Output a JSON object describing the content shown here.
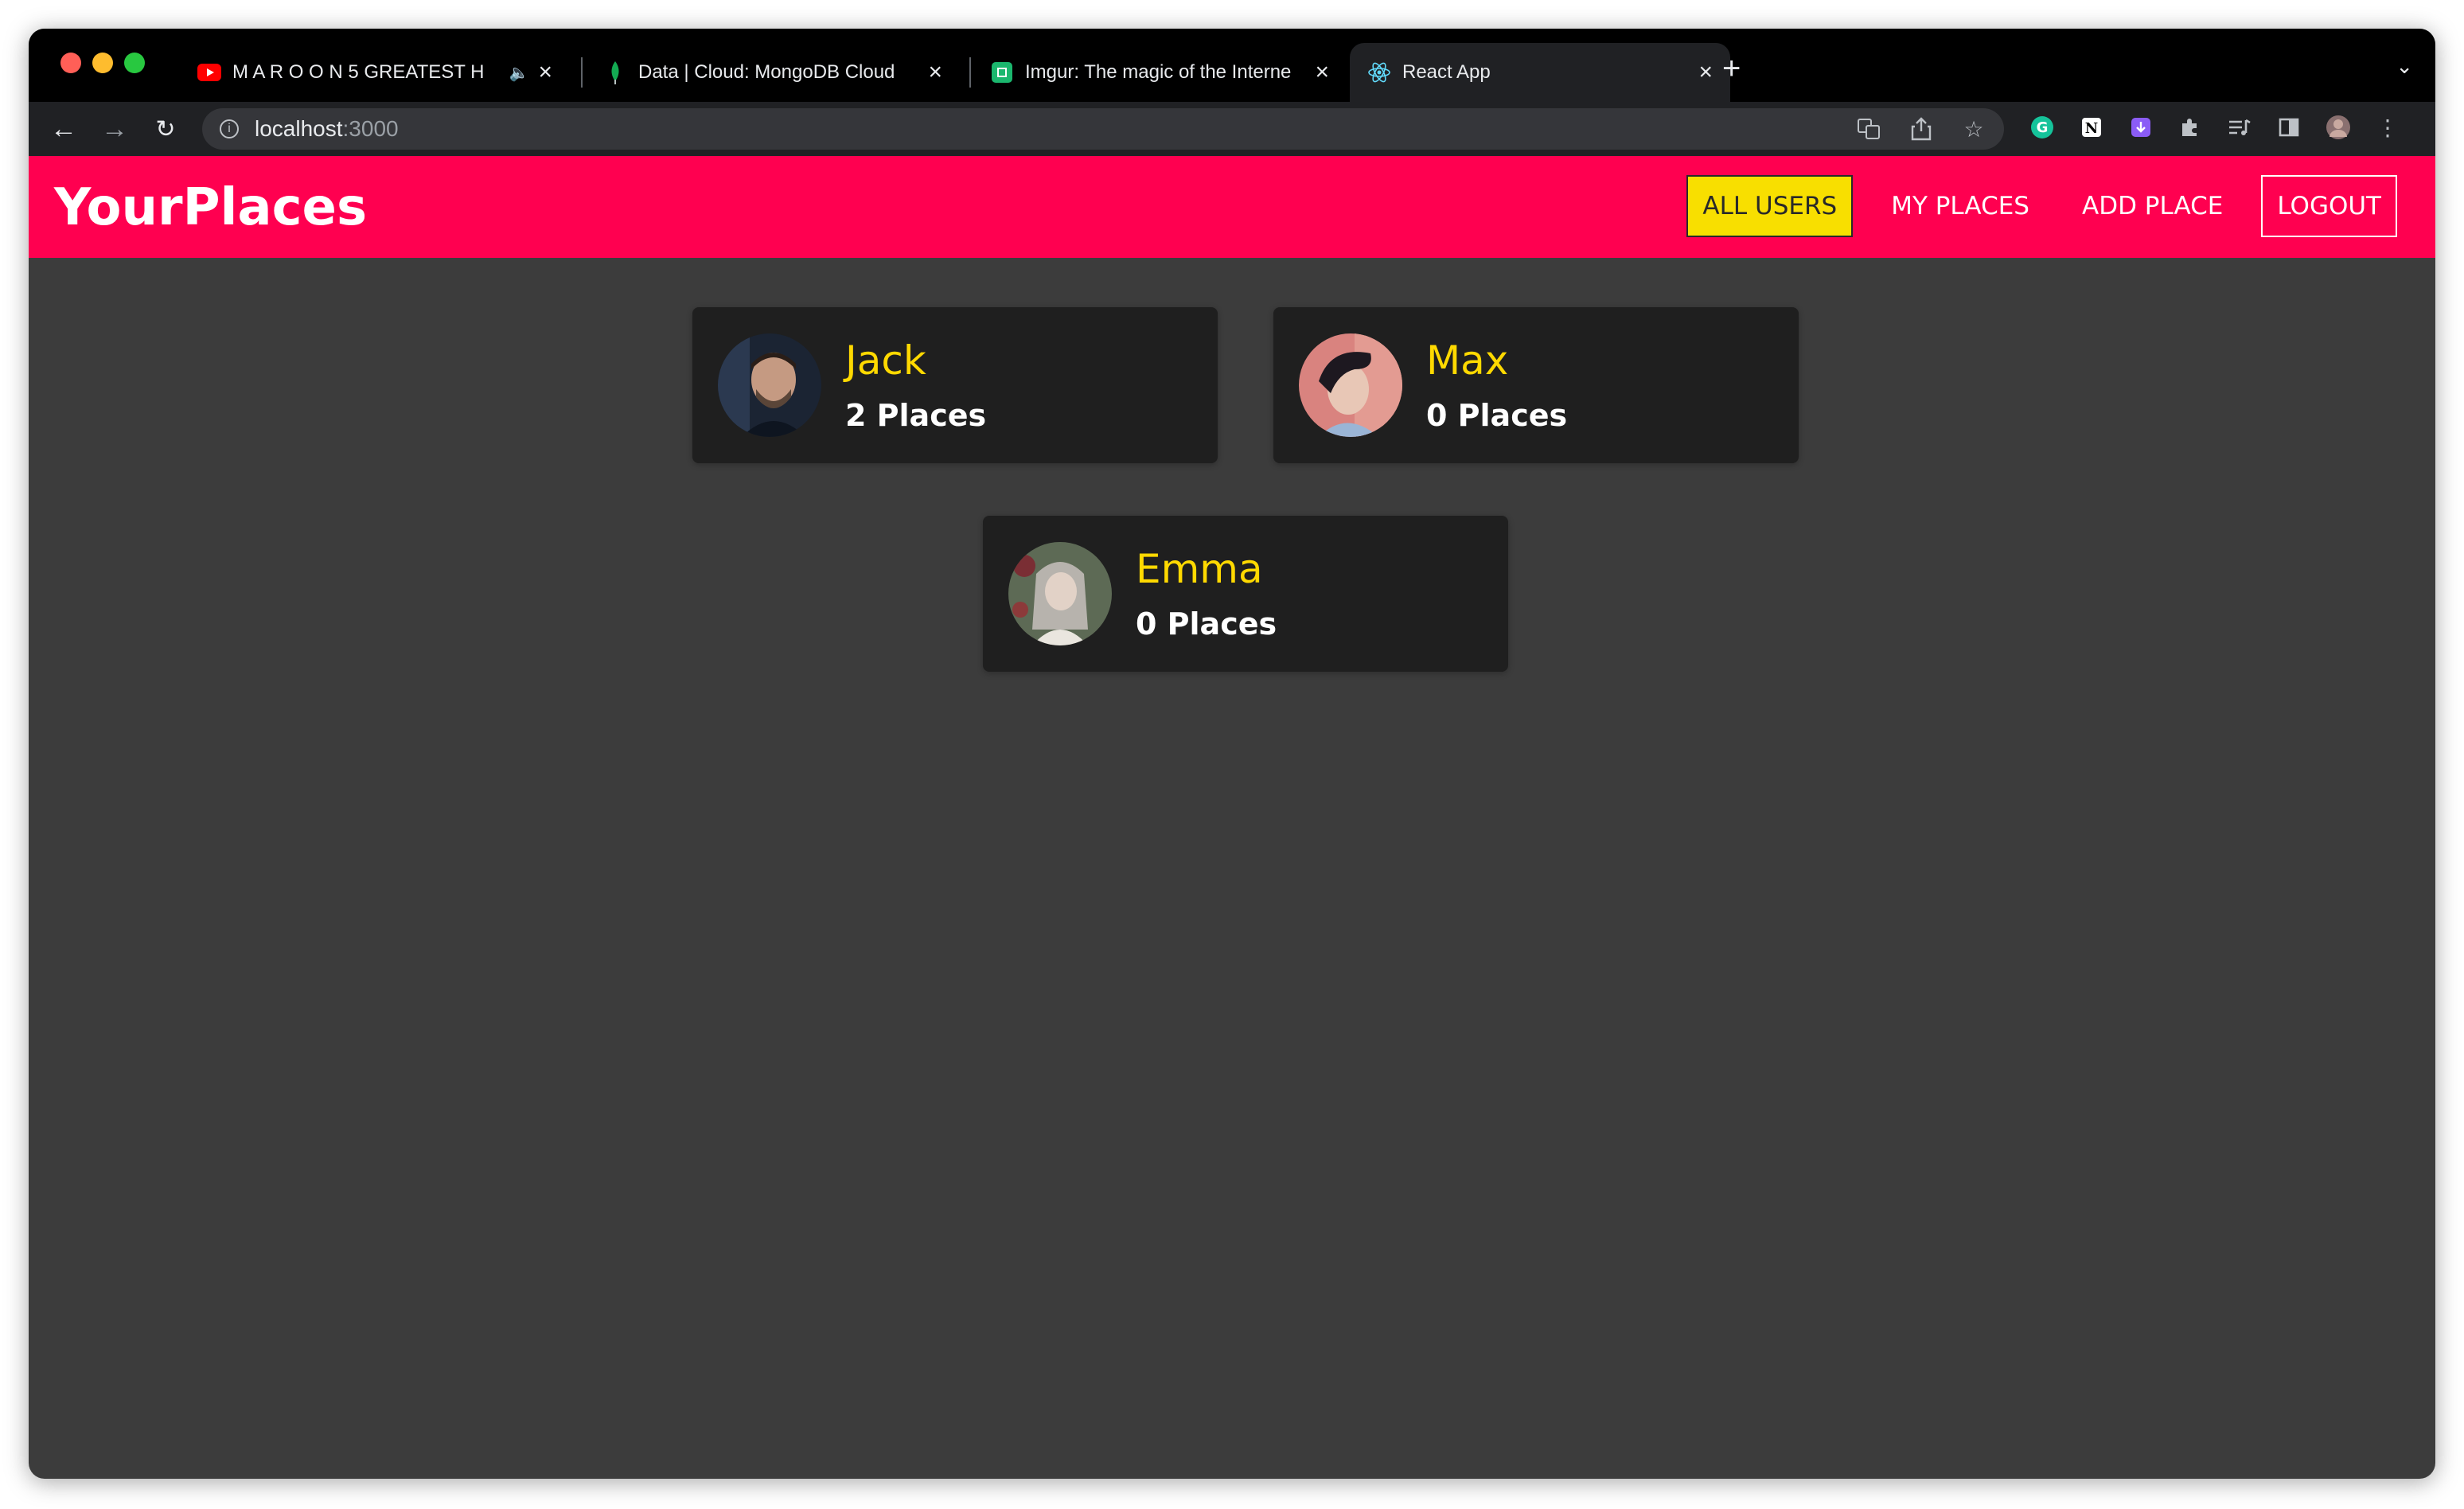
{
  "browser": {
    "tabs": [
      {
        "title": "M A R O O N 5 GREATEST H",
        "favicon": "youtube-icon",
        "audio": true
      },
      {
        "title": "Data | Cloud: MongoDB Cloud",
        "favicon": "mongodb-leaf-icon"
      },
      {
        "title": "Imgur: The magic of the Interne",
        "favicon": "imgur-icon"
      },
      {
        "title": "React App",
        "favicon": "react-icon",
        "active": true
      }
    ],
    "url_host": "localhost",
    "url_port": ":3000"
  },
  "app": {
    "brand": "YourPlaces",
    "nav": {
      "all_users": "ALL USERS",
      "my_places": "MY PLACES",
      "add_place": "ADD PLACE",
      "logout": "LOGOUT"
    },
    "users": [
      {
        "name": "Jack",
        "places": "2 Places"
      },
      {
        "name": "Max",
        "places": "0 Places"
      },
      {
        "name": "Emma",
        "places": "0 Places"
      }
    ]
  },
  "colors": {
    "header": "#ff0050",
    "accent": "#f8df00",
    "card": "#1f1f1f",
    "page": "#3c3c3c",
    "name": "#ffd900"
  }
}
